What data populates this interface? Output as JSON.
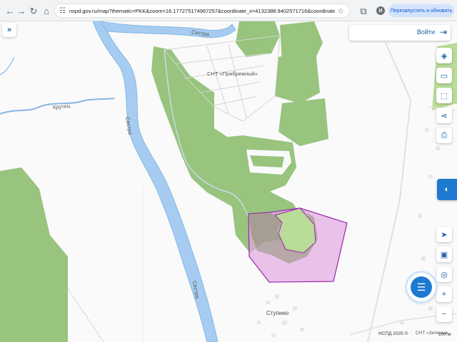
{
  "browser": {
    "url": "nspd.gov.ru/map?thematic=PKK&zoom=16.177275174967257&coordinate_x=4132388.9402571716&coordinate_y=76...",
    "avatar_letter": "И",
    "restart_label": "Перезапустить и обновить",
    "icons": {
      "back": "arrow-left-icon",
      "forward": "arrow-right-icon",
      "reload": "reload-icon",
      "home": "home-icon",
      "site_info": "tune-icon",
      "bookmark": "star-icon",
      "extensions": "puzzle-icon"
    }
  },
  "map": {
    "labels": {
      "snt_priberezhny": "СНТ «Прибрежный»",
      "river_sestra_top": "Сестра",
      "river_sestra_mid": "Сестра",
      "river_sestra_bottom": "Сестра",
      "stream_kruteц": "Крутец",
      "village_stupino": "Ступино",
      "snt_bottom": "СНТ «Зеленые..."
    },
    "colors": {
      "forest": "#98c47e",
      "field": "#b9dc98",
      "water": "#a6cdf1",
      "water_edge": "#85b7e4",
      "parcel_fill": "#e2a8e0",
      "parcel_stroke": "#9c27b0",
      "accent": "#1e7ad1"
    }
  },
  "controls": {
    "collapse_icon": "chevrons-right-icon",
    "login_label": "Войти",
    "login_icon": "login-arrow-icon",
    "right_toolbar": [
      "layers-icon",
      "ruler-icon",
      "area-select-icon",
      "share-icon",
      "print-icon",
      "pkk-logo-icon",
      "geolocation-icon",
      "map-type-icon",
      "location-pin-icon",
      "zoom-in-icon",
      "zoom-out-icon"
    ],
    "chat_icon": "chat-icon"
  },
  "footer": {
    "attribution": "НСПД 2025 ©",
    "scale": "100 м"
  }
}
